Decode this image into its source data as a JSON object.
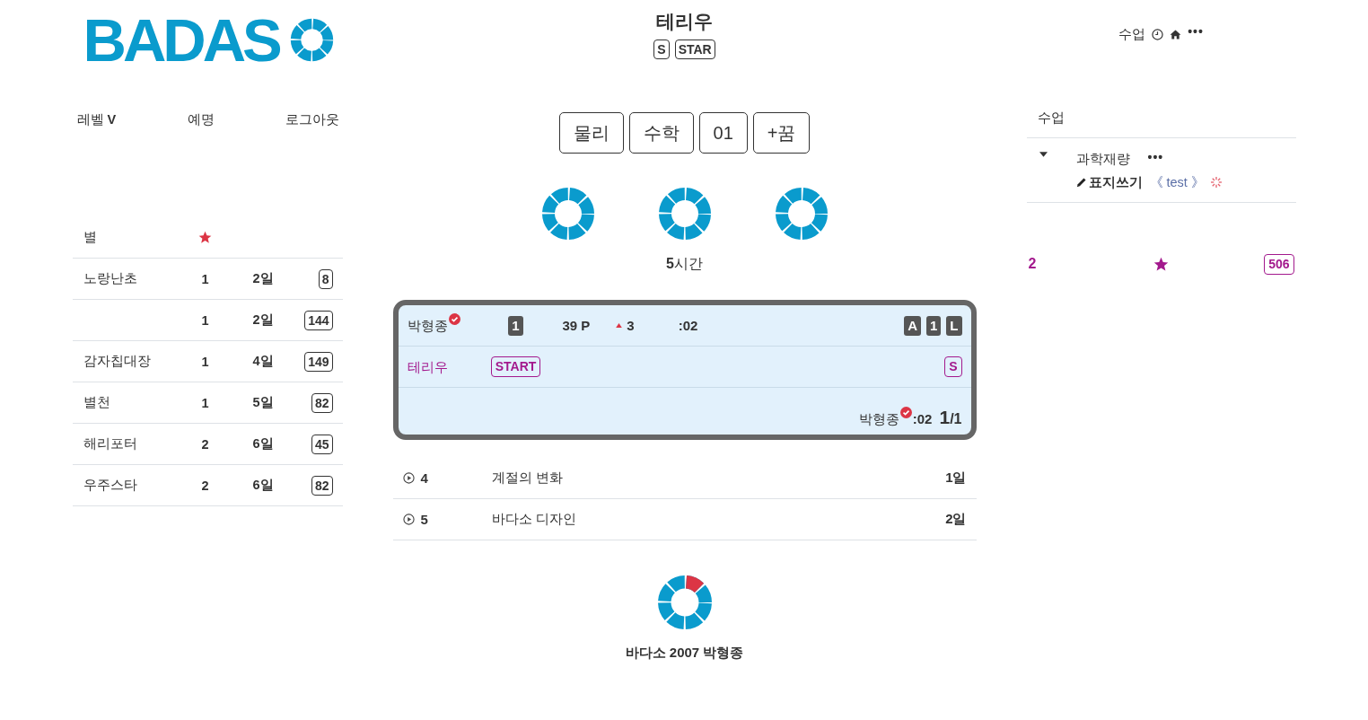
{
  "header": {
    "logo": "BADAS",
    "title": "테리우",
    "title_badges": [
      "S",
      "STAR"
    ],
    "nav": {
      "label": "수업",
      "more": "•••"
    }
  },
  "account_menu": [
    "레벨 **V**",
    "예명",
    "로그아웃"
  ],
  "leaderboard": {
    "header": "별",
    "rows": [
      {
        "name": "노랑난초",
        "count": "1",
        "days": "2일",
        "score": "8"
      },
      {
        "count": "1",
        "days": "2일",
        "score": "144"
      },
      {
        "name": "감자칩대장",
        "count": "1",
        "days": "4일",
        "score": "149"
      },
      {
        "name": "별천",
        "count": "1",
        "days": "5일",
        "score": "82"
      },
      {
        "name": "해리포터",
        "count": "2",
        "days": "6일",
        "score": "45"
      },
      {
        "name": "우주스타",
        "count": "2",
        "days": "6일",
        "score": "82"
      }
    ]
  },
  "subjects": [
    "물리",
    "수학",
    "01",
    "+꿈"
  ],
  "duration": "**5**시간",
  "match": {
    "player": {
      "name": "박형종",
      "verified": true,
      "rank": "1",
      "points": "39 P",
      "trend": {
        "kind": "up",
        "value": "3"
      },
      "time": ":02",
      "tags": [
        "A",
        "1",
        "L"
      ]
    },
    "opponent": {
      "name": "테리우",
      "status": "START",
      "grade": "S"
    },
    "summary": {
      "name": "박형종",
      "verified": true,
      "time": ":02",
      "score": "**1**/1"
    }
  },
  "lessons": [
    {
      "number": "4",
      "title": "계절의 변화",
      "days": "1일"
    },
    {
      "number": "5",
      "title": "바다소 디자인",
      "days": "2일"
    }
  ],
  "footer": {
    "text": "바다소 2007 박형종"
  },
  "classes": {
    "title": "수업",
    "items": [
      {
        "title": "과학재량",
        "more": "•••",
        "expanded": true,
        "children": [
          {
            "label": "표지쓰기",
            "tag": "《 test 》",
            "loading": true
          }
        ]
      }
    ]
  },
  "stats": {
    "count": "2",
    "score": "506"
  }
}
